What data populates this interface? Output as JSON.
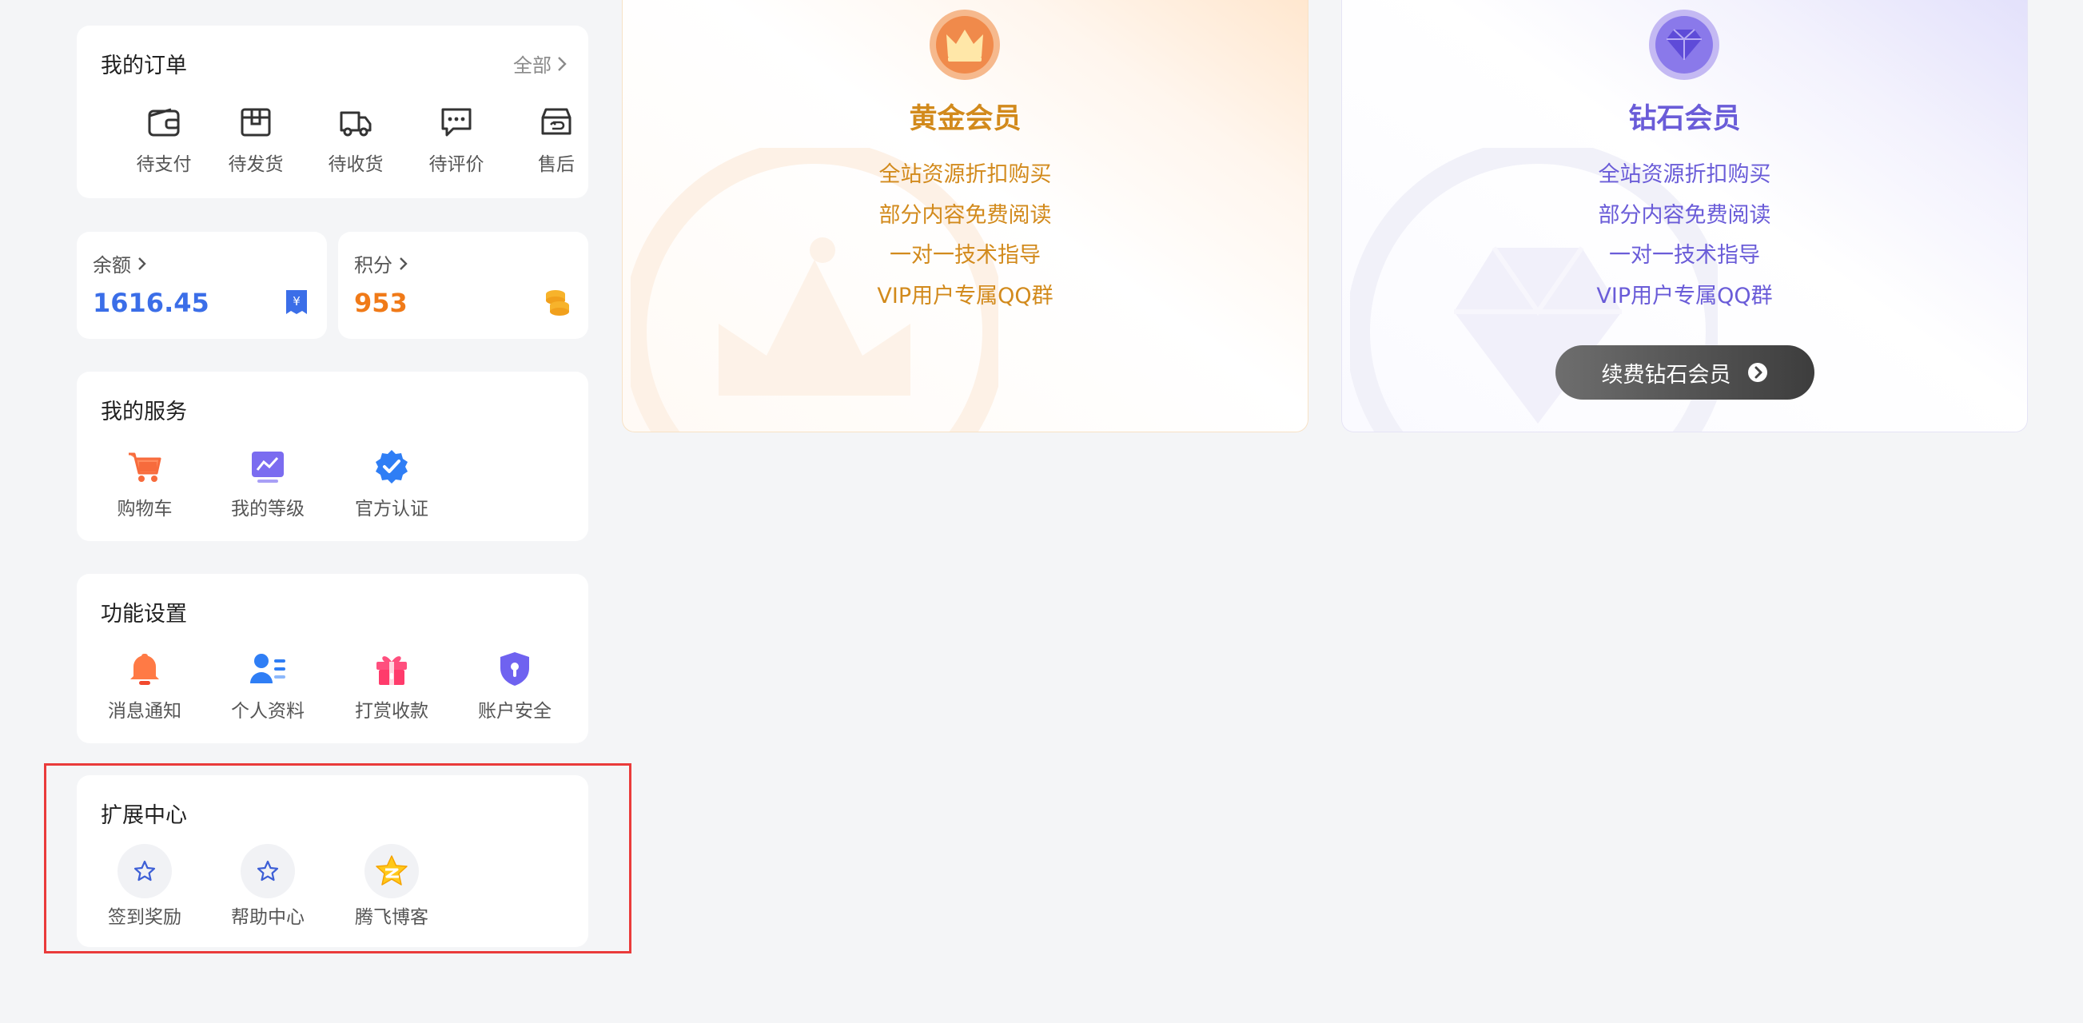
{
  "orders": {
    "title": "我的订单",
    "all_label": "全部",
    "items": [
      {
        "label": "待支付",
        "icon": "wallet-icon"
      },
      {
        "label": "待发货",
        "icon": "package-icon"
      },
      {
        "label": "待收货",
        "icon": "truck-icon"
      },
      {
        "label": "待评价",
        "icon": "comment-icon"
      },
      {
        "label": "售后",
        "icon": "return-icon"
      }
    ]
  },
  "balance": {
    "label": "余额",
    "value": "1616.45",
    "color": "#3b6ee8"
  },
  "points": {
    "label": "积分",
    "value": "953",
    "color": "#f07a18"
  },
  "services": {
    "title": "我的服务",
    "items": [
      {
        "label": "购物车",
        "icon": "cart-icon"
      },
      {
        "label": "我的等级",
        "icon": "level-icon"
      },
      {
        "label": "官方认证",
        "icon": "verified-icon"
      }
    ]
  },
  "settings": {
    "title": "功能设置",
    "items": [
      {
        "label": "消息通知",
        "icon": "bell-icon"
      },
      {
        "label": "个人资料",
        "icon": "profile-icon"
      },
      {
        "label": "打赏收款",
        "icon": "gift-icon"
      },
      {
        "label": "账户安全",
        "icon": "shield-icon"
      }
    ]
  },
  "extensions": {
    "title": "扩展中心",
    "items": [
      {
        "label": "签到奖励",
        "icon": "star-icon"
      },
      {
        "label": "帮助中心",
        "icon": "star-icon"
      },
      {
        "label": "腾飞博客",
        "icon": "qzone-star-icon"
      }
    ]
  },
  "gold": {
    "title": "黄金会员",
    "color": "#d28a1c",
    "features": [
      "全站资源折扣购买",
      "部分内容免费阅读",
      "一对一技术指导",
      "VIP用户专属QQ群"
    ]
  },
  "diamond": {
    "title": "钻石会员",
    "color": "#6a5cd8",
    "features": [
      "全站资源折扣购买",
      "部分内容免费阅读",
      "一对一技术指导",
      "VIP用户专属QQ群"
    ],
    "button_label": "续费钻石会员"
  }
}
